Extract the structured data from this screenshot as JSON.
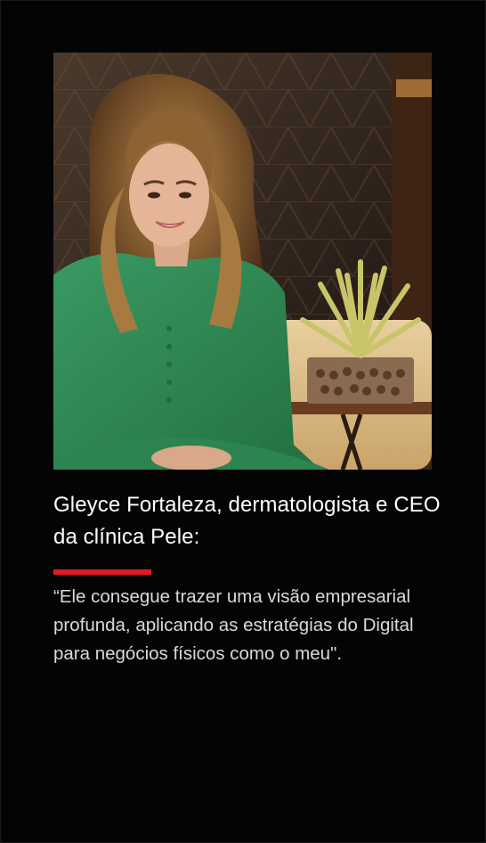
{
  "testimonial": {
    "name_line": "Gleyce Fortaleza, dermatologista e CEO da clínica Pele:",
    "quote": "“Ele consegue trazer uma visão empresarial profunda, aplicando as estratégias do Digital para negócios físicos como o meu\"."
  },
  "photo": {
    "subject": "woman-in-green-dress-portrait"
  },
  "colors": {
    "background": "#050405",
    "name_text": "#ffffff",
    "quote_text": "#d9d9d9",
    "accent": "#e21b22",
    "dress": "#2f8a55"
  }
}
